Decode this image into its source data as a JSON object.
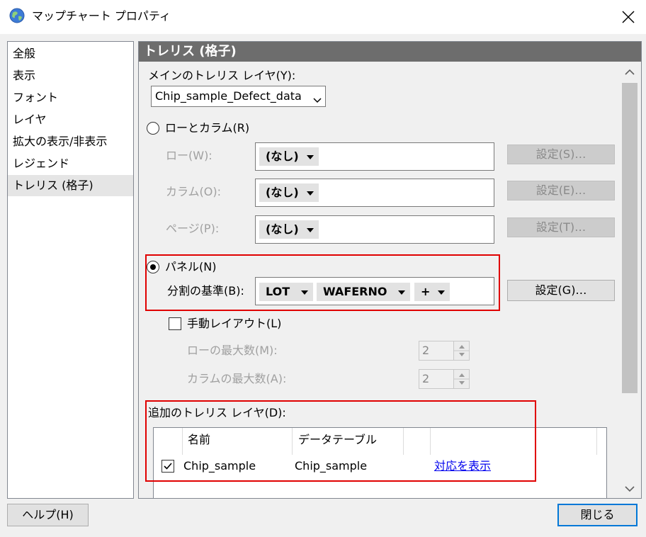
{
  "window": {
    "title": "マップチャート プロパティ",
    "icon": "globe-icon",
    "close_icon": "close-icon"
  },
  "sidebar": {
    "items": [
      {
        "label": "全般"
      },
      {
        "label": "表示"
      },
      {
        "label": "フォント"
      },
      {
        "label": "レイヤ"
      },
      {
        "label": "拡大の表示/非表示"
      },
      {
        "label": "レジェンド"
      },
      {
        "label": "トレリス (格子)",
        "selected": true
      }
    ]
  },
  "content": {
    "header": "トレリス (格子)",
    "main_layer": {
      "label": "メインのトレリス レイヤ(Y):",
      "value": "Chip_sample_Defect_data"
    },
    "row_column": {
      "label": "ローとカラム(R)",
      "selected": false,
      "rows": [
        {
          "label": "ロー(W):",
          "value": "(なし)",
          "button": "設定(S)…"
        },
        {
          "label": "カラム(O):",
          "value": "(なし)",
          "button": "設定(E)…"
        },
        {
          "label": "ページ(P):",
          "value": "(なし)",
          "button": "設定(T)…"
        }
      ]
    },
    "panel": {
      "label": "パネル(N)",
      "selected": true,
      "split_label": "分割の基準(B):",
      "split_items": [
        "LOT",
        "WAFERNO",
        "+"
      ],
      "button": "設定(G)…"
    },
    "manual_layout": {
      "label": "手動レイアウト(L)",
      "checked": false,
      "max_rows_label": "ローの最大数(M):",
      "max_rows_value": "2",
      "max_cols_label": "カラムの最大数(A):",
      "max_cols_value": "2"
    },
    "additional_layers": {
      "label": "追加のトレリス レイヤ(D):",
      "columns": [
        "名前",
        "データテーブル"
      ],
      "rows": [
        {
          "checked": true,
          "name": "Chip_sample",
          "table": "Chip_sample",
          "link": "対応を表示"
        }
      ]
    }
  },
  "footer": {
    "help": "ヘルプ(H)",
    "close": "閉じる"
  },
  "colors": {
    "highlight_border": "#e00000",
    "header_bg": "#6d6d6d",
    "link": "#0000ee"
  }
}
